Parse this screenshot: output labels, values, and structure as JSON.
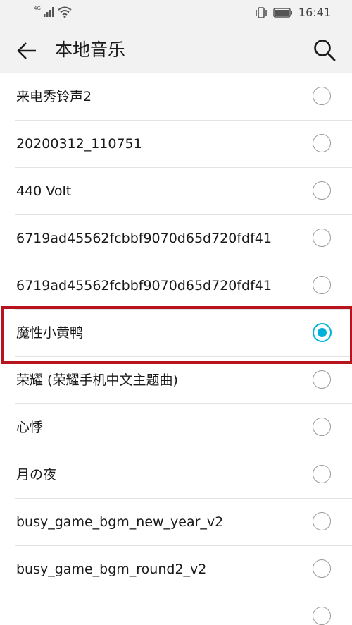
{
  "status_bar": {
    "network_label": "4G",
    "time": "16:41",
    "icons": [
      "signal-icon",
      "wifi-icon",
      "vibrate-icon",
      "battery-icon"
    ]
  },
  "header": {
    "title": "本地音乐",
    "back_icon": "arrow-left-icon",
    "search_icon": "search-icon"
  },
  "colors": {
    "accent": "#00b0d8",
    "highlight_border": "#b8141e",
    "header_bg": "#f2f2f2"
  },
  "list": {
    "items": [
      {
        "label": "来电秀铃声2",
        "selected": false
      },
      {
        "label": "20200312_110751",
        "selected": false
      },
      {
        "label": "440 Volt",
        "selected": false
      },
      {
        "label": "6719ad45562fcbbf9070d65d720fdf41",
        "selected": false
      },
      {
        "label": "6719ad45562fcbbf9070d65d720fdf41",
        "selected": false
      },
      {
        "label": "魔性小黄鸭",
        "selected": true
      },
      {
        "label": "荣耀 (荣耀手机中文主题曲)",
        "selected": false
      },
      {
        "label": "心悸",
        "selected": false
      },
      {
        "label": "月の夜",
        "selected": false
      },
      {
        "label": "busy_game_bgm_new_year_v2",
        "selected": false
      },
      {
        "label": "busy_game_bgm_round2_v2",
        "selected": false
      }
    ]
  }
}
